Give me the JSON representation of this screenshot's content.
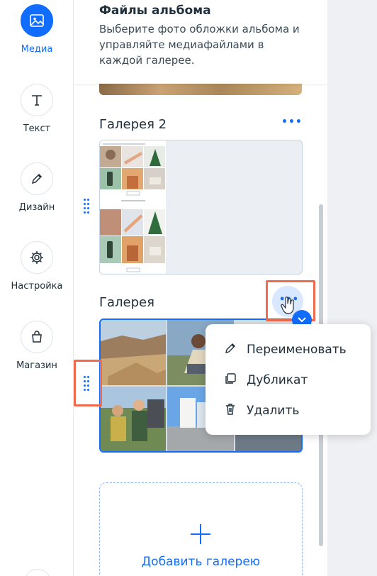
{
  "sidebar": {
    "items": [
      {
        "label": "Медиа",
        "icon": "image-icon",
        "active": true
      },
      {
        "label": "Текст",
        "icon": "text-icon"
      },
      {
        "label": "Дизайн",
        "icon": "pencil-icon"
      },
      {
        "label": "Настройка",
        "icon": "gear-icon"
      },
      {
        "label": "Магазин",
        "icon": "shopping-bag-icon"
      }
    ]
  },
  "panel": {
    "title": "Файлы альбома",
    "description": "Выберите фото обложки альбома и управляйте медиафайлами в каждой галерее."
  },
  "galleries": [
    {
      "title": "Галерея 2",
      "more": "•••"
    },
    {
      "title": "Галерея",
      "more": "•••"
    }
  ],
  "context_menu": {
    "items": [
      {
        "label": "Переименовать",
        "icon": "pencil-icon"
      },
      {
        "label": "Дубликат",
        "icon": "duplicate-icon"
      },
      {
        "label": "Удалить",
        "icon": "trash-icon"
      }
    ]
  },
  "add_gallery": {
    "label": "Добавить галерею"
  },
  "colors": {
    "accent": "#116dff",
    "highlight": "#f06a4d"
  }
}
